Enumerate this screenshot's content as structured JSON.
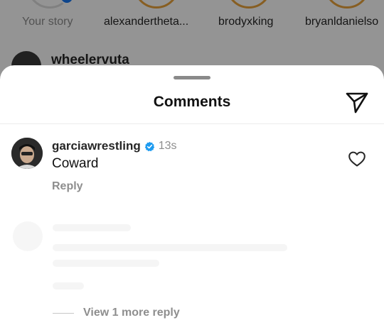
{
  "stories": [
    {
      "name": "Your story",
      "own": true
    },
    {
      "name": "alexanderthetа...",
      "own": false
    },
    {
      "name": "brodyxking",
      "own": false
    },
    {
      "name": "bryanldanielso",
      "own": false
    }
  ],
  "feed": {
    "username": "wheelervuta"
  },
  "sheet": {
    "title": "Comments",
    "share_icon": "paper-plane-icon"
  },
  "comment": {
    "username": "garciawrestling",
    "verified": true,
    "time": "13s",
    "text": "Coward",
    "reply_label": "Reply",
    "like_icon": "heart-outline-icon"
  },
  "view_replies_label": "View 1 more reply",
  "colors": {
    "verified_blue": "#1d9bf0",
    "story_ring": "#e9a23b",
    "muted_text": "#8e8e8e"
  }
}
